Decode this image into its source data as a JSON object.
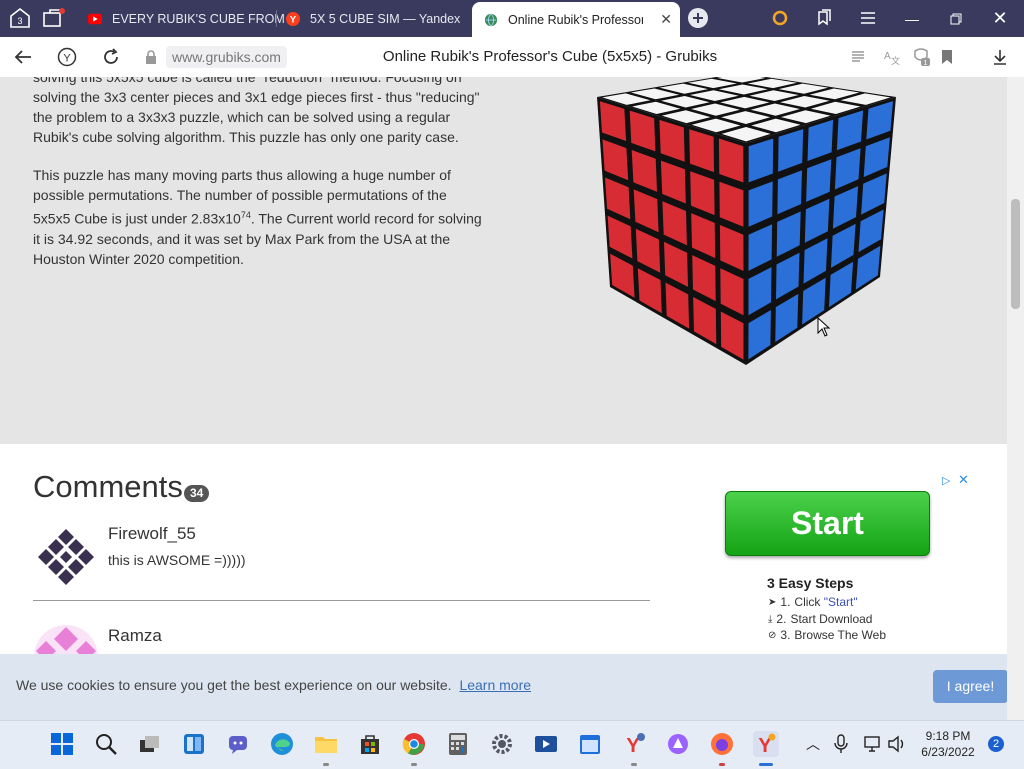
{
  "browser": {
    "tab_count_badge": "3",
    "tabs": [
      {
        "label": "EVERY RUBIK'S CUBE FROM",
        "icon": "youtube-icon"
      },
      {
        "label": "5X 5 CUBE SIM — Yandex",
        "icon": "yandex-icon"
      },
      {
        "label": "Online Rubik's Professor's",
        "icon": "globe-icon",
        "active": true
      }
    ],
    "url": "www.grubiks.com",
    "page_title": "Online Rubik's Professor's Cube (5x5x5) - Grubiks",
    "translate_badge": "1"
  },
  "article": {
    "para1_lines": [
      "solving this 5x5x5 cube is called the \"reduction\" method. Focusing on",
      "solving the 3x3 center pieces and 3x1 edge pieces first - thus \"reducing\"",
      "the problem to a 3x3x3 puzzle, which can be solved using a regular",
      "Rubik's cube solving algorithm. This puzzle has only one parity case."
    ],
    "para2_line1": "This puzzle has many moving parts thus allowing a huge number of",
    "para2_line2": "possible permutations. The number of possible permutations of the",
    "para2_line3_pre": "5x5x5 Cube is just under 2.83x10",
    "para2_line3_sup": "74",
    "para2_line3_post": ". The Current world record for solving",
    "para2_line4": "it is 34.92 seconds, and it was set by Max Park from the USA at the",
    "para2_line5": "Houston Winter 2020 competition."
  },
  "cube": {
    "colors": {
      "top": "#f5f5f5",
      "left": "#d82c35",
      "right": "#2b6fd9",
      "frame": "#111111"
    }
  },
  "comments": {
    "title": "Comments",
    "count": "34",
    "items": [
      {
        "name": "Firewolf_55",
        "text": "this is AWSOME =)))))"
      },
      {
        "name": "Ramza",
        "text": ""
      }
    ]
  },
  "ad": {
    "start_label": "Start",
    "steps_title": "3 Easy Steps",
    "steps": [
      {
        "num": "1.",
        "text_pre": "Click ",
        "link": "\"Start\""
      },
      {
        "num": "2.",
        "text_pre": "Start Download",
        "link": ""
      },
      {
        "num": "3.",
        "text_pre": "Browse The Web",
        "link": ""
      }
    ]
  },
  "cookie": {
    "text": "We use cookies to ensure you get the best experience on our website.",
    "learn_more": "Learn more",
    "agree": "I agree!"
  },
  "taskbar": {
    "time": "9:18 PM",
    "date": "6/23/2022",
    "notifications": "2"
  }
}
